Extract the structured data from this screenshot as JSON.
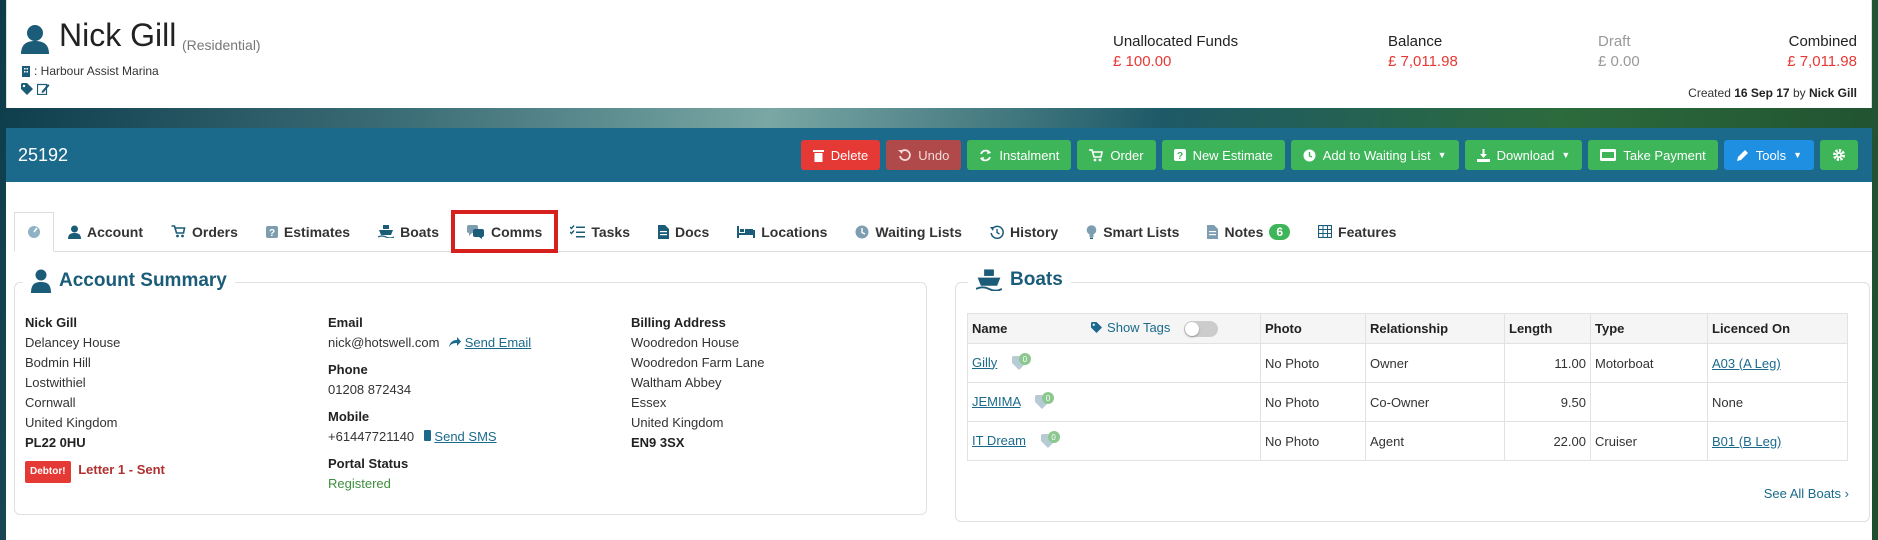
{
  "header": {
    "name": "Nick Gill",
    "type": "(Residential)",
    "marina": ": Harbour Assist Marina",
    "unallocated_label": "Unallocated Funds",
    "unallocated_value": "£ 100.00",
    "balance_label": "Balance",
    "balance_value": "£ 7,011.98",
    "draft_label": "Draft",
    "draft_value": "£ 0.00",
    "combined_label": "Combined",
    "combined_value": "£ 7,011.98",
    "created_prefix": "Created",
    "created_date": "16 Sep 17",
    "created_by_prefix": "by",
    "created_by": "Nick Gill"
  },
  "account_number": "25192",
  "toolbar": {
    "delete": "Delete",
    "undo": "Undo",
    "instalment": "Instalment",
    "order": "Order",
    "new_estimate": "New Estimate",
    "add_waiting": "Add to Waiting List",
    "download": "Download",
    "take_payment": "Take Payment",
    "tools": "Tools"
  },
  "tabs": {
    "account": "Account",
    "orders": "Orders",
    "estimates": "Estimates",
    "boats": "Boats",
    "comms": "Comms",
    "tasks": "Tasks",
    "docs": "Docs",
    "locations": "Locations",
    "waiting_lists": "Waiting Lists",
    "history": "History",
    "smart_lists": "Smart Lists",
    "notes": "Notes",
    "notes_count": "6",
    "features": "Features"
  },
  "account_summary": {
    "title": "Account Summary",
    "name": "Nick Gill",
    "address": [
      "Delancey House",
      "Bodmin Hill",
      "Lostwithiel",
      "Cornwall",
      "United Kingdom"
    ],
    "postcode": "PL22 0HU",
    "debtor_badge": "Debtor!",
    "letter_status": "Letter 1 - Sent",
    "email_label": "Email",
    "email": "nick@hotswell.com",
    "send_email": "Send Email",
    "phone_label": "Phone",
    "phone": "01208 872434",
    "mobile_label": "Mobile",
    "mobile": "+61447721140",
    "send_sms": "Send SMS",
    "portal_label": "Portal Status",
    "portal_value": "Registered",
    "billing_label": "Billing Address",
    "billing": [
      "Woodredon House",
      "Woodredon Farm Lane",
      "Waltham Abbey",
      "Essex",
      "United Kingdom"
    ],
    "billing_postcode": "EN9 3SX"
  },
  "boats_panel": {
    "title": "Boats",
    "columns": {
      "name": "Name",
      "show_tags": "Show Tags",
      "photo": "Photo",
      "relationship": "Relationship",
      "length": "Length",
      "type": "Type",
      "licenced_on": "Licenced On"
    },
    "rows": [
      {
        "name": "Gilly",
        "tags": "0",
        "photo": "No Photo",
        "relationship": "Owner",
        "length": "11.00",
        "type": "Motorboat",
        "licenced": "A03 (A Leg)"
      },
      {
        "name": "JEMIMA",
        "tags": "0",
        "photo": "No Photo",
        "relationship": "Co-Owner",
        "length": "9.50",
        "type": "",
        "licenced": "None"
      },
      {
        "name": "IT Dream",
        "tags": "0",
        "photo": "No Photo",
        "relationship": "Agent",
        "length": "22.00",
        "type": "Cruiser",
        "licenced": "B01 (B Leg)"
      }
    ],
    "see_all": "See All Boats"
  },
  "colors": {
    "accent": "#1b6a8c",
    "danger": "#e53935",
    "success": "#3fb55a",
    "primary": "#1e8fe1"
  }
}
